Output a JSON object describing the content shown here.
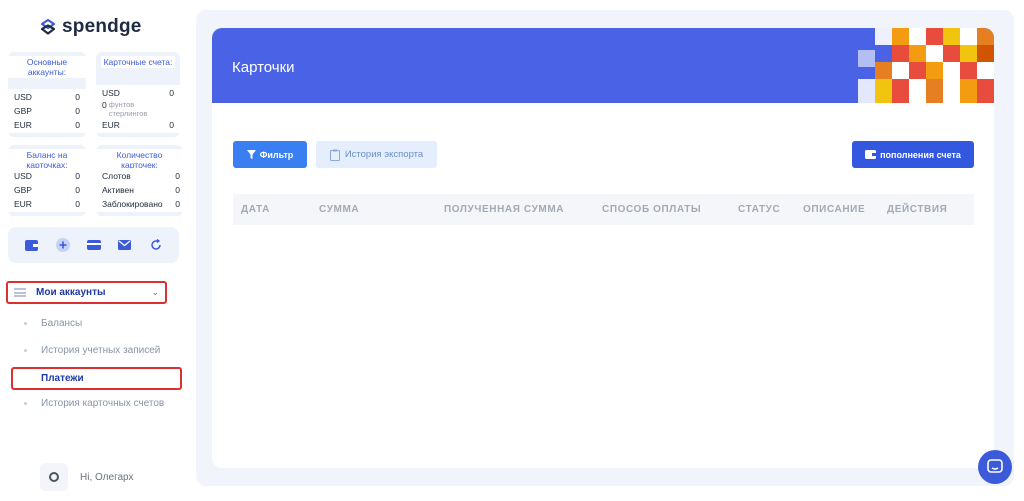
{
  "brand": {
    "name": "spendge"
  },
  "sidebar": {
    "boxes": [
      {
        "title": "Основные аккаунты:",
        "rows": [
          {
            "label": "USD",
            "value": "0"
          },
          {
            "label": "GBP",
            "value": "0"
          },
          {
            "label": "EUR",
            "value": "0"
          }
        ]
      },
      {
        "title": "Карточные счета:",
        "rows": [
          {
            "label": "USD",
            "value": "0"
          },
          {
            "label": "0",
            "value": "фунтов стерлингов"
          },
          {
            "label": "EUR",
            "value": "0"
          }
        ]
      },
      {
        "title": "Баланс на карточках:",
        "rows": [
          {
            "label": "USD",
            "value": "0"
          },
          {
            "label": "GBP",
            "value": "0"
          },
          {
            "label": "EUR",
            "value": "0"
          }
        ]
      },
      {
        "title": "Количество карточек:",
        "rows": [
          {
            "label": "Слотов",
            "value": "0"
          },
          {
            "label": "Активен",
            "value": "0"
          },
          {
            "label": "Заблокировано",
            "value": "0"
          }
        ]
      }
    ],
    "menu": {
      "label": "Мои аккаунты",
      "items": [
        "Балансы",
        "История учетных записей",
        "Платежи",
        "История карточных счетов"
      ]
    },
    "user": {
      "greeting": "Hi, Олегарх"
    }
  },
  "main": {
    "title": "Карточки",
    "filter_label": "Фильтр",
    "export_label": "История экспорта",
    "topup_label": "пополнения счета",
    "columns": [
      "ДАТА",
      "СУММА",
      "ПОЛУЧЕННАЯ СУММА",
      "СПОСОБ ОПЛАТЫ",
      "СТАТУС",
      "ОПИСАНИЕ",
      "ДЕЙСТВИЯ"
    ]
  },
  "colors": {
    "accent": "#4a63e6",
    "button": "#3a7ff2",
    "highlight": "#d93030"
  }
}
